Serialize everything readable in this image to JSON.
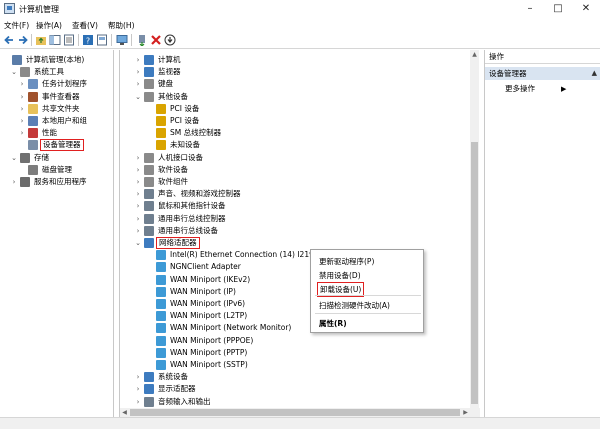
{
  "window": {
    "title": "计算机管理"
  },
  "menu": [
    "文件(F)",
    "操作(A)",
    "查看(V)",
    "帮助(H)"
  ],
  "left_tree": [
    {
      "label": "计算机管理(本地)",
      "expander": "",
      "level": 0,
      "icon": "computer-manage-icon",
      "color": "#5a7ca8"
    },
    {
      "label": "系统工具",
      "expander": "⌄",
      "level": 1,
      "icon": "tools-icon",
      "color": "#8a8a8a"
    },
    {
      "label": "任务计划程序",
      "expander": "›",
      "level": 2,
      "icon": "clock-icon",
      "color": "#6a8fc0"
    },
    {
      "label": "事件查看器",
      "expander": "›",
      "level": 2,
      "icon": "event-viewer-icon",
      "color": "#a0522d"
    },
    {
      "label": "共享文件夹",
      "expander": "›",
      "level": 2,
      "icon": "shared-folder-icon",
      "color": "#e8c15a"
    },
    {
      "label": "本地用户和组",
      "expander": "›",
      "level": 2,
      "icon": "users-icon",
      "color": "#5c7fb5"
    },
    {
      "label": "性能",
      "expander": "›",
      "level": 2,
      "icon": "performance-icon",
      "color": "#c43a3a"
    },
    {
      "label": "设备管理器",
      "expander": "",
      "level": 2,
      "icon": "device-manager-icon",
      "color": "#7a8ea8",
      "highlighted": true
    },
    {
      "label": "存储",
      "expander": "⌄",
      "level": 1,
      "icon": "storage-icon",
      "color": "#707070"
    },
    {
      "label": "磁盘管理",
      "expander": "",
      "level": 2,
      "icon": "disk-icon",
      "color": "#7d7d7d"
    },
    {
      "label": "服务和应用程序",
      "expander": "›",
      "level": 1,
      "icon": "services-icon",
      "color": "#6b6b6b"
    }
  ],
  "device_tree": [
    {
      "label": "计算机",
      "expander": "›",
      "level": 0,
      "icon": "computer-icon",
      "color": "#3d7bbf"
    },
    {
      "label": "监视器",
      "expander": "›",
      "level": 0,
      "icon": "monitor-icon",
      "color": "#3d7bbf"
    },
    {
      "label": "键盘",
      "expander": "›",
      "level": 0,
      "icon": "keyboard-icon",
      "color": "#8a8a8a"
    },
    {
      "label": "其他设备",
      "expander": "⌄",
      "level": 0,
      "icon": "other-devices-icon",
      "color": "#8a8a8a"
    },
    {
      "label": "PCI 设备",
      "expander": "",
      "level": 1,
      "icon": "unknown-device-icon",
      "color": "#d9a400"
    },
    {
      "label": "PCI 设备",
      "expander": "",
      "level": 1,
      "icon": "unknown-device-icon",
      "color": "#d9a400"
    },
    {
      "label": "SM 总线控制器",
      "expander": "",
      "level": 1,
      "icon": "unknown-device-icon",
      "color": "#d9a400"
    },
    {
      "label": "未知设备",
      "expander": "",
      "level": 1,
      "icon": "unknown-device-icon",
      "color": "#d9a400"
    },
    {
      "label": "人机接口设备",
      "expander": "›",
      "level": 0,
      "icon": "hid-icon",
      "color": "#8a8a8a"
    },
    {
      "label": "软件设备",
      "expander": "›",
      "level": 0,
      "icon": "software-device-icon",
      "color": "#8a8a8a"
    },
    {
      "label": "软件组件",
      "expander": "›",
      "level": 0,
      "icon": "software-component-icon",
      "color": "#8a8a8a"
    },
    {
      "label": "声音、视频和游戏控制器",
      "expander": "›",
      "level": 0,
      "icon": "sound-icon",
      "color": "#6f7f8f"
    },
    {
      "label": "鼠标和其他指针设备",
      "expander": "›",
      "level": 0,
      "icon": "mouse-icon",
      "color": "#6f7f8f"
    },
    {
      "label": "通用串行总线控制器",
      "expander": "›",
      "level": 0,
      "icon": "usb-icon",
      "color": "#6f7f8f"
    },
    {
      "label": "通用串行总线设备",
      "expander": "›",
      "level": 0,
      "icon": "usb-device-icon",
      "color": "#6f7f8f"
    },
    {
      "label": "网络适配器",
      "expander": "⌄",
      "level": 0,
      "icon": "network-adapter-icon",
      "color": "#3d7bbf",
      "highlighted": true
    },
    {
      "label": "Intel(R) Ethernet Connection (14) I219",
      "expander": "",
      "level": 1,
      "icon": "network-card-icon",
      "color": "#3d9ad6",
      "selected": true
    },
    {
      "label": "NGNClient Adapter",
      "expander": "",
      "level": 1,
      "icon": "network-card-icon",
      "color": "#3d9ad6"
    },
    {
      "label": "WAN Miniport (IKEv2)",
      "expander": "",
      "level": 1,
      "icon": "network-card-icon",
      "color": "#3d9ad6"
    },
    {
      "label": "WAN Miniport (IP)",
      "expander": "",
      "level": 1,
      "icon": "network-card-icon",
      "color": "#3d9ad6"
    },
    {
      "label": "WAN Miniport (IPv6)",
      "expander": "",
      "level": 1,
      "icon": "network-card-icon",
      "color": "#3d9ad6"
    },
    {
      "label": "WAN Miniport (L2TP)",
      "expander": "",
      "level": 1,
      "icon": "network-card-icon",
      "color": "#3d9ad6"
    },
    {
      "label": "WAN Miniport (Network Monitor)",
      "expander": "",
      "level": 1,
      "icon": "network-card-icon",
      "color": "#3d9ad6"
    },
    {
      "label": "WAN Miniport (PPPOE)",
      "expander": "",
      "level": 1,
      "icon": "network-card-icon",
      "color": "#3d9ad6"
    },
    {
      "label": "WAN Miniport (PPTP)",
      "expander": "",
      "level": 1,
      "icon": "network-card-icon",
      "color": "#3d9ad6"
    },
    {
      "label": "WAN Miniport (SSTP)",
      "expander": "",
      "level": 1,
      "icon": "network-card-icon",
      "color": "#3d9ad6"
    },
    {
      "label": "系统设备",
      "expander": "›",
      "level": 0,
      "icon": "system-device-icon",
      "color": "#3d7bbf"
    },
    {
      "label": "显示适配器",
      "expander": "›",
      "level": 0,
      "icon": "display-adapter-icon",
      "color": "#3d7bbf"
    },
    {
      "label": "音频输入和输出",
      "expander": "›",
      "level": 0,
      "icon": "audio-icon",
      "color": "#6f7f8f"
    }
  ],
  "context_menu": {
    "update_driver": "更新驱动程序(P)",
    "disable_device": "禁用设备(D)",
    "uninstall_device": "卸载设备(U)",
    "scan_hardware": "扫描检测硬件改动(A)",
    "properties": "属性(R)"
  },
  "actions_pane": {
    "header": "操作",
    "section": "设备管理器",
    "more_actions": "更多操作"
  },
  "colors": {
    "highlight_border": "#e02020",
    "selection": "#cce4f7",
    "section_bg": "#d9e4f1"
  }
}
